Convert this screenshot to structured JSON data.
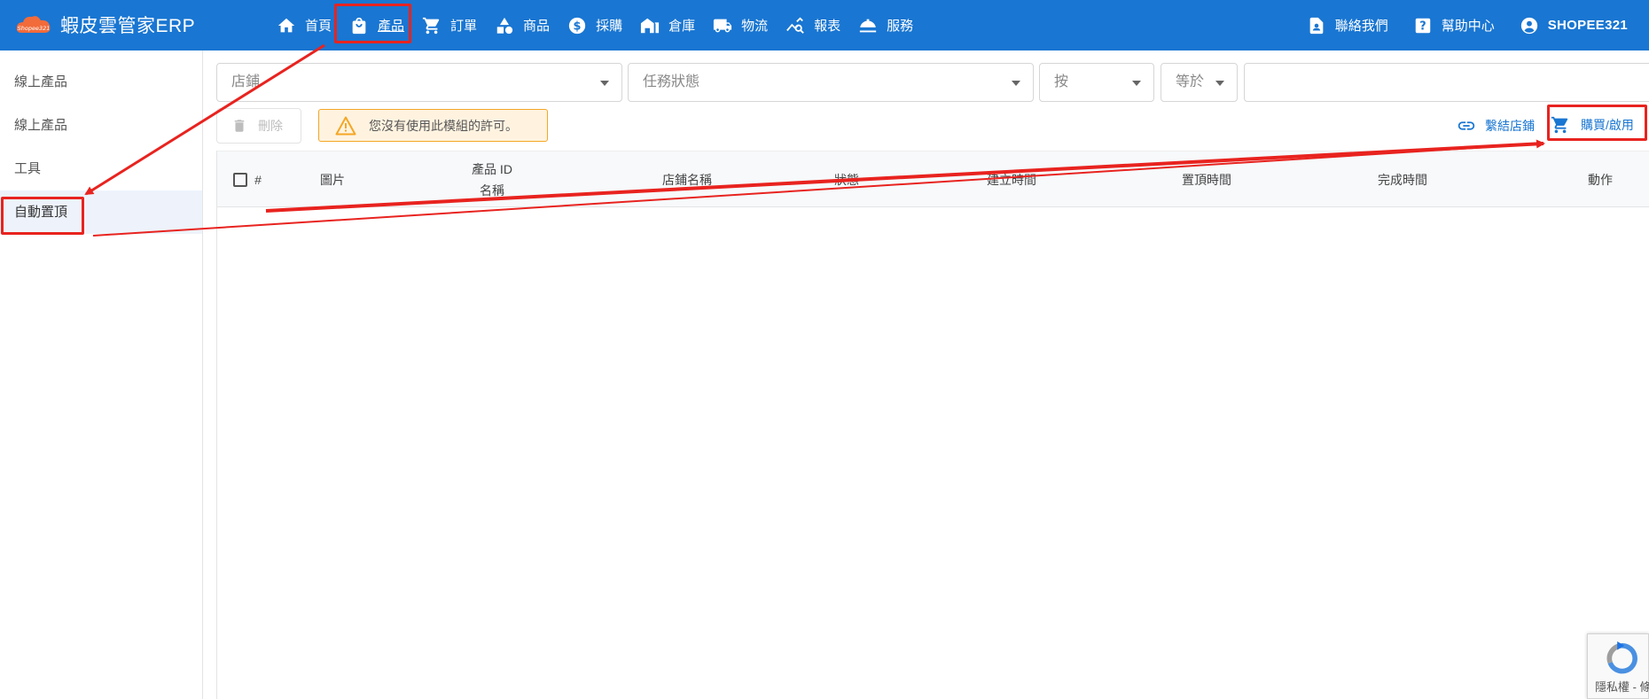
{
  "app": {
    "brand_name": "蝦皮雲管家ERP",
    "logo_text": "Shopee321"
  },
  "nav": {
    "items": [
      {
        "label": "首頁",
        "icon": "home-icon"
      },
      {
        "label": "產品",
        "icon": "bag-icon",
        "active": true
      },
      {
        "label": "訂單",
        "icon": "cart-icon"
      },
      {
        "label": "商品",
        "icon": "shapes-icon"
      },
      {
        "label": "採購",
        "icon": "dollar-icon"
      },
      {
        "label": "倉庫",
        "icon": "warehouse-icon"
      },
      {
        "label": "物流",
        "icon": "truck-icon"
      },
      {
        "label": "報表",
        "icon": "chart-search-icon"
      },
      {
        "label": "服務",
        "icon": "service-bell-icon"
      }
    ],
    "right": {
      "contact_label": "聯絡我們",
      "help_label": "幫助中心",
      "user_label": "SHOPEE321"
    }
  },
  "sidebar": {
    "items": [
      {
        "label": "線上產品"
      },
      {
        "label": "線上產品"
      },
      {
        "label": "工具"
      },
      {
        "label": "自動置頂",
        "active": true
      }
    ]
  },
  "filters": {
    "store_placeholder": "店鋪",
    "status_placeholder": "任務狀態",
    "by_label": "按",
    "op_label": "等於",
    "search_value": ""
  },
  "toolbar": {
    "delete_label": "刪除",
    "warning_text": "您沒有使用此模組的許可。",
    "bind_store_label": "繫結店鋪",
    "buy_label": "購買/啟用"
  },
  "table": {
    "columns": {
      "hash": "#",
      "image": "圖片",
      "product_id": "產品 ID",
      "name": "名稱",
      "store_name": "店鋪名稱",
      "status": "狀態",
      "created_at": "建立時間",
      "pinned_at": "置頂時間",
      "completed_at": "完成時間",
      "actions": "動作"
    }
  },
  "recaptcha": {
    "text": "隱私權 - 條款"
  },
  "colors": {
    "topbar": "#1976d2",
    "annotation": "#e8231f",
    "warning_bg": "#fff3e0",
    "warning_border": "#f5a623"
  }
}
